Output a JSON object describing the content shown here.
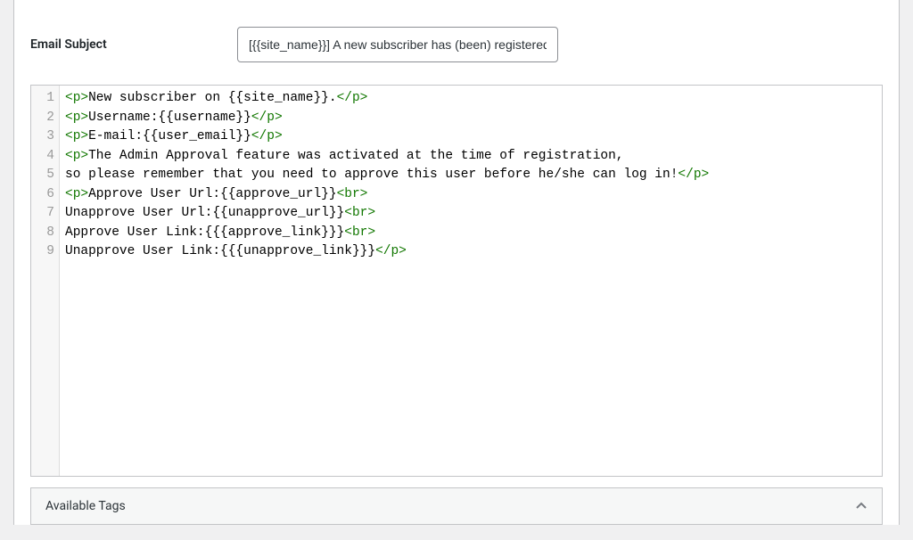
{
  "form": {
    "email_subject_label": "Email Subject",
    "email_subject_value": "[{{site_name}}] A new subscriber has (been) registered"
  },
  "editor": {
    "lines": [
      {
        "num": "1",
        "segments": [
          {
            "c": "tag",
            "t": "<p>"
          },
          {
            "c": "txt",
            "t": "New subscriber on {{site_name}}."
          },
          {
            "c": "tag",
            "t": "</p>"
          }
        ]
      },
      {
        "num": "2",
        "segments": [
          {
            "c": "tag",
            "t": "<p>"
          },
          {
            "c": "txt",
            "t": "Username:{{username}}"
          },
          {
            "c": "tag",
            "t": "</p>"
          }
        ]
      },
      {
        "num": "3",
        "segments": [
          {
            "c": "tag",
            "t": "<p>"
          },
          {
            "c": "txt",
            "t": "E-mail:{{user_email}}"
          },
          {
            "c": "tag",
            "t": "</p>"
          }
        ]
      },
      {
        "num": "4",
        "segments": [
          {
            "c": "tag",
            "t": "<p>"
          },
          {
            "c": "txt",
            "t": "The Admin Approval feature was activated at the time of registration,"
          }
        ]
      },
      {
        "num": "5",
        "segments": [
          {
            "c": "txt",
            "t": "so please remember that you need to approve this user before he/she can log in!"
          },
          {
            "c": "tag",
            "t": "</p>"
          }
        ]
      },
      {
        "num": "6",
        "segments": [
          {
            "c": "tag",
            "t": "<p>"
          },
          {
            "c": "txt",
            "t": "Approve User Url:{{approve_url}}"
          },
          {
            "c": "tag",
            "t": "<br>"
          }
        ]
      },
      {
        "num": "7",
        "segments": [
          {
            "c": "txt",
            "t": "Unapprove User Url:{{unapprove_url}}"
          },
          {
            "c": "tag",
            "t": "<br>"
          }
        ]
      },
      {
        "num": "8",
        "segments": [
          {
            "c": "txt",
            "t": "Approve User Link:{{{approve_link}}}"
          },
          {
            "c": "tag",
            "t": "<br>"
          }
        ]
      },
      {
        "num": "9",
        "segments": [
          {
            "c": "txt",
            "t": "Unapprove User Link:{{{unapprove_link}}}"
          },
          {
            "c": "tag",
            "t": "</p>"
          }
        ]
      }
    ]
  },
  "accordion": {
    "available_tags_label": "Available Tags"
  }
}
